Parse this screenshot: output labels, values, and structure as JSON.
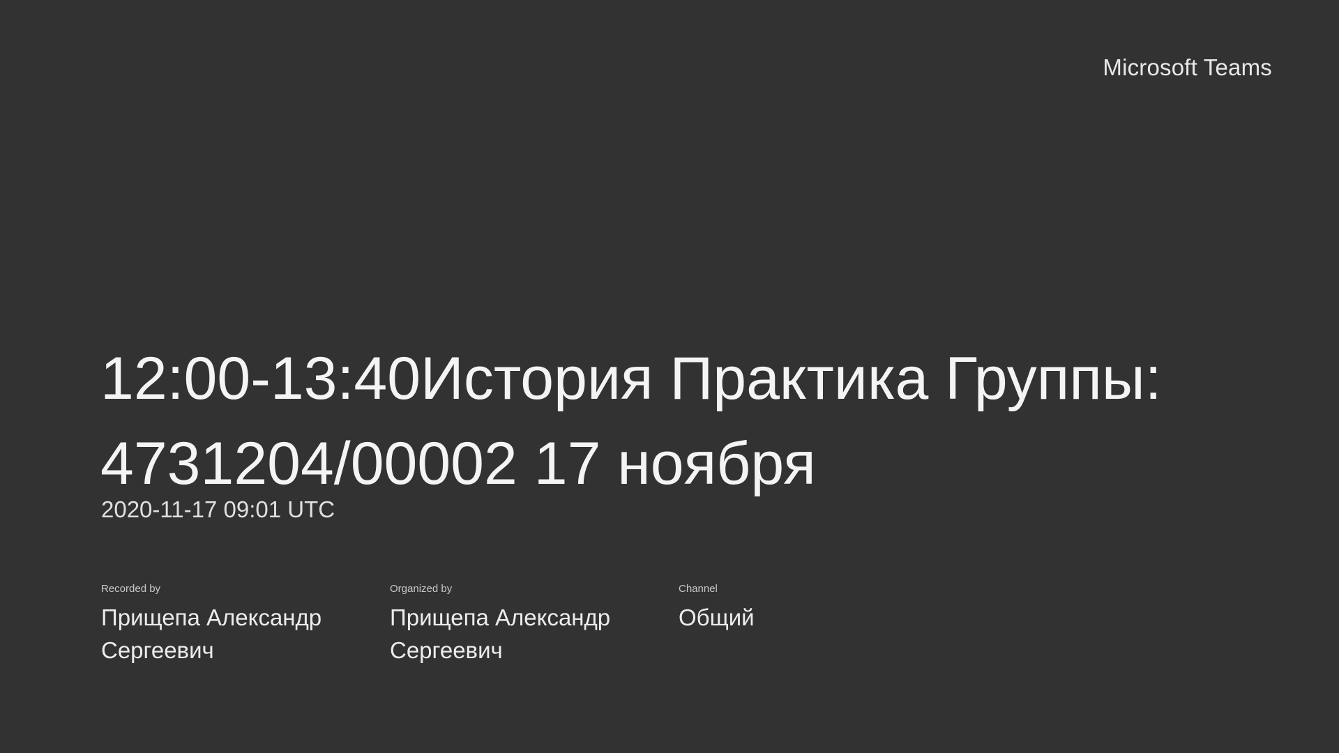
{
  "brand": "Microsoft Teams",
  "title": "12:00-13:40История Практика Группы: 4731204/00002 17 ноября",
  "timestamp": "2020-11-17 09:01 UTC",
  "meta": [
    {
      "label": "Recorded by",
      "value": "Прищепа Александр Сергеевич"
    },
    {
      "label": "Organized by",
      "value": "Прищепа Александр Сергеевич"
    },
    {
      "label": "Channel",
      "value": "Общий"
    }
  ]
}
